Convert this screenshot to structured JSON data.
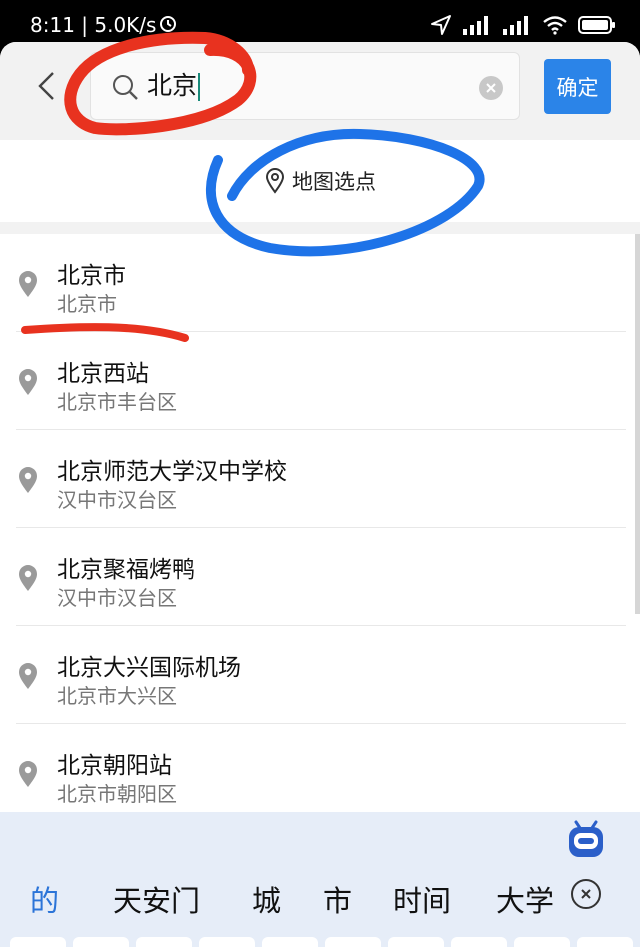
{
  "status_bar": {
    "time_speed": "8:11 | 5.0K/s"
  },
  "search": {
    "back_icon": "chevron-left-icon",
    "query": "北京",
    "confirm_label": "确定"
  },
  "map_pick": {
    "label": "地图选点"
  },
  "results": [
    {
      "name": "北京市",
      "address": "北京市"
    },
    {
      "name": "北京西站",
      "address": "北京市丰台区"
    },
    {
      "name": "北京师范大学汉中学校",
      "address": "汉中市汉台区"
    },
    {
      "name": "北京聚福烤鸭",
      "address": "汉中市汉台区"
    },
    {
      "name": "北京大兴国际机场",
      "address": "北京市大兴区"
    },
    {
      "name": "北京朝阳站",
      "address": "北京市朝阳区"
    }
  ],
  "keyboard": {
    "candidates": [
      "的",
      "天安门",
      "城",
      "市",
      "时间",
      "大学"
    ]
  },
  "colors": {
    "accent": "#2b84e8",
    "annotation_red": "#e8321f",
    "annotation_blue": "#1e73e8"
  }
}
